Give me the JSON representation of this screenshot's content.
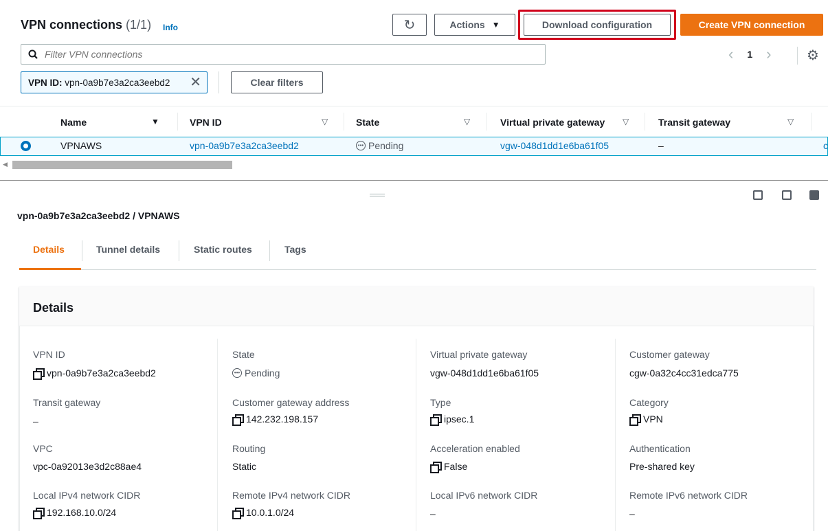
{
  "header": {
    "title": "VPN connections",
    "count": "(1/1)",
    "info": "Info",
    "actions_label": "Actions",
    "download_label": "Download configuration",
    "create_label": "Create VPN connection"
  },
  "search": {
    "placeholder": "Filter VPN connections"
  },
  "pagination": {
    "page": "1"
  },
  "filter": {
    "token_key": "VPN ID:",
    "token_value": "vpn-0a9b7e3a2ca3eebd2",
    "clear_label": "Clear filters"
  },
  "table": {
    "columns": [
      "Name",
      "VPN ID",
      "State",
      "Virtual private gateway",
      "Transit gateway"
    ],
    "row": {
      "name": "VPNAWS",
      "vpn_id": "vpn-0a9b7e3a2ca3eebd2",
      "state": "Pending",
      "vgw": "vgw-048d1dd1e6ba61f05",
      "tgw": "–",
      "cut_off": "c"
    }
  },
  "detail": {
    "title": "vpn-0a9b7e3a2ca3eebd2 / VPNAWS",
    "tabs": [
      "Details",
      "Tunnel details",
      "Static routes",
      "Tags"
    ],
    "panel_title": "Details",
    "fields": {
      "vpn_id": {
        "label": "VPN ID",
        "value": "vpn-0a9b7e3a2ca3eebd2"
      },
      "state": {
        "label": "State",
        "value": "Pending"
      },
      "vgw": {
        "label": "Virtual private gateway",
        "value": "vgw-048d1dd1e6ba61f05"
      },
      "cgw": {
        "label": "Customer gateway",
        "value": "cgw-0a32c4cc31edca775"
      },
      "tgw": {
        "label": "Transit gateway",
        "value": "–"
      },
      "cgw_address": {
        "label": "Customer gateway address",
        "value": "142.232.198.157"
      },
      "type": {
        "label": "Type",
        "value": "ipsec.1"
      },
      "category": {
        "label": "Category",
        "value": "VPN"
      },
      "vpc": {
        "label": "VPC",
        "value": "vpc-0a92013e3d2c88ae4"
      },
      "routing": {
        "label": "Routing",
        "value": "Static"
      },
      "acceleration": {
        "label": "Acceleration enabled",
        "value": "False"
      },
      "authentication": {
        "label": "Authentication",
        "value": "Pre-shared key"
      },
      "local_ipv4": {
        "label": "Local IPv4 network CIDR",
        "value": "192.168.10.0/24"
      },
      "remote_ipv4": {
        "label": "Remote IPv4 network CIDR",
        "value": "10.0.1.0/24"
      },
      "local_ipv6": {
        "label": "Local IPv6 network CIDR",
        "value": "–"
      },
      "remote_ipv6": {
        "label": "Remote IPv6 network CIDR",
        "value": "–"
      }
    }
  },
  "colors": {
    "accent": "#ec7211",
    "link": "#0073bb",
    "highlight_box": "#d0021b",
    "selected_row": "#f1faff"
  },
  "icons": [
    "refresh-icon",
    "caret-down-icon",
    "search-icon",
    "chevron-left-icon",
    "chevron-right-icon",
    "settings-icon",
    "close-icon",
    "sort-icon",
    "pending-icon",
    "copy-icon",
    "drag-handle-icon",
    "panel-layout-icon"
  ]
}
